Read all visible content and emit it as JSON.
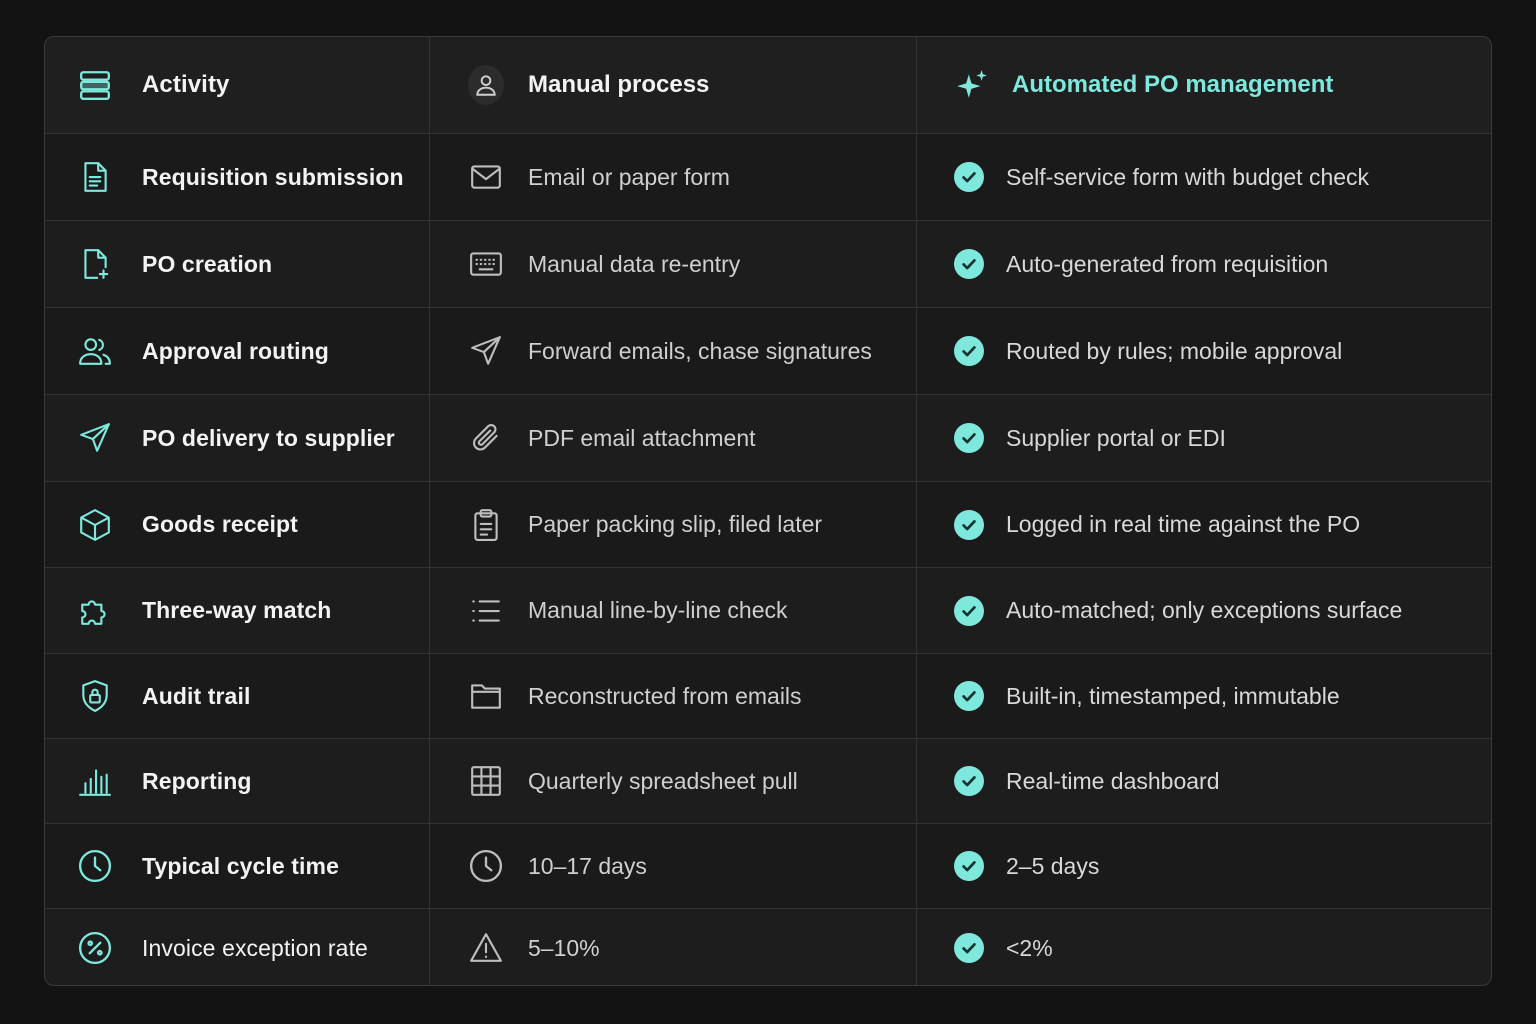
{
  "colors": {
    "accent": "#7ee8dc",
    "background": "#131313",
    "panel": "#1d1d1d",
    "border": "#333333"
  },
  "header": {
    "activity": "Activity",
    "manual": "Manual process",
    "automated": "Automated PO management",
    "activity_icon": "server-stack-icon",
    "manual_icon": "user-icon",
    "automated_icon": "sparkle-icon"
  },
  "rows": [
    {
      "activity": "Requisition submission",
      "manual": "Email or paper form",
      "automated": "Self-service form with budget check",
      "activity_icon": "document-icon",
      "manual_icon": "envelope-icon"
    },
    {
      "activity": "PO creation",
      "manual": "Manual data re-entry",
      "automated": "Auto-generated from requisition",
      "activity_icon": "file-plus-icon",
      "manual_icon": "keyboard-icon"
    },
    {
      "activity": "Approval routing",
      "manual": "Forward emails, chase signatures",
      "automated": "Routed by rules; mobile approval",
      "activity_icon": "users-icon",
      "manual_icon": "send-icon"
    },
    {
      "activity": "PO delivery to supplier",
      "manual": "PDF email attachment",
      "automated": "Supplier portal or EDI",
      "activity_icon": "send-icon",
      "manual_icon": "paperclip-icon"
    },
    {
      "activity": "Goods receipt",
      "manual": "Paper packing slip, filed later",
      "automated": "Logged in real time against the PO",
      "activity_icon": "box-icon",
      "manual_icon": "clipboard-icon"
    },
    {
      "activity": "Three-way match",
      "manual": "Manual line-by-line check",
      "automated": "Auto-matched; only exceptions surface",
      "activity_icon": "puzzle-icon",
      "manual_icon": "list-icon"
    },
    {
      "activity": "Audit trail",
      "manual": "Reconstructed from emails",
      "automated": "Built-in, timestamped, immutable",
      "activity_icon": "shield-lock-icon",
      "manual_icon": "folder-icon"
    },
    {
      "activity": "Reporting",
      "manual": "Quarterly spreadsheet pull",
      "automated": "Real-time dashboard",
      "activity_icon": "bar-chart-icon",
      "manual_icon": "grid-icon"
    },
    {
      "activity": "Typical cycle time",
      "manual": "10–17 days",
      "automated": "2–5 days",
      "activity_icon": "clock-icon",
      "manual_icon": "clock-icon"
    },
    {
      "activity": "Invoice exception rate",
      "manual": "5–10%",
      "automated": "<2%",
      "activity_icon": "percent-icon",
      "manual_icon": "warning-icon"
    }
  ]
}
